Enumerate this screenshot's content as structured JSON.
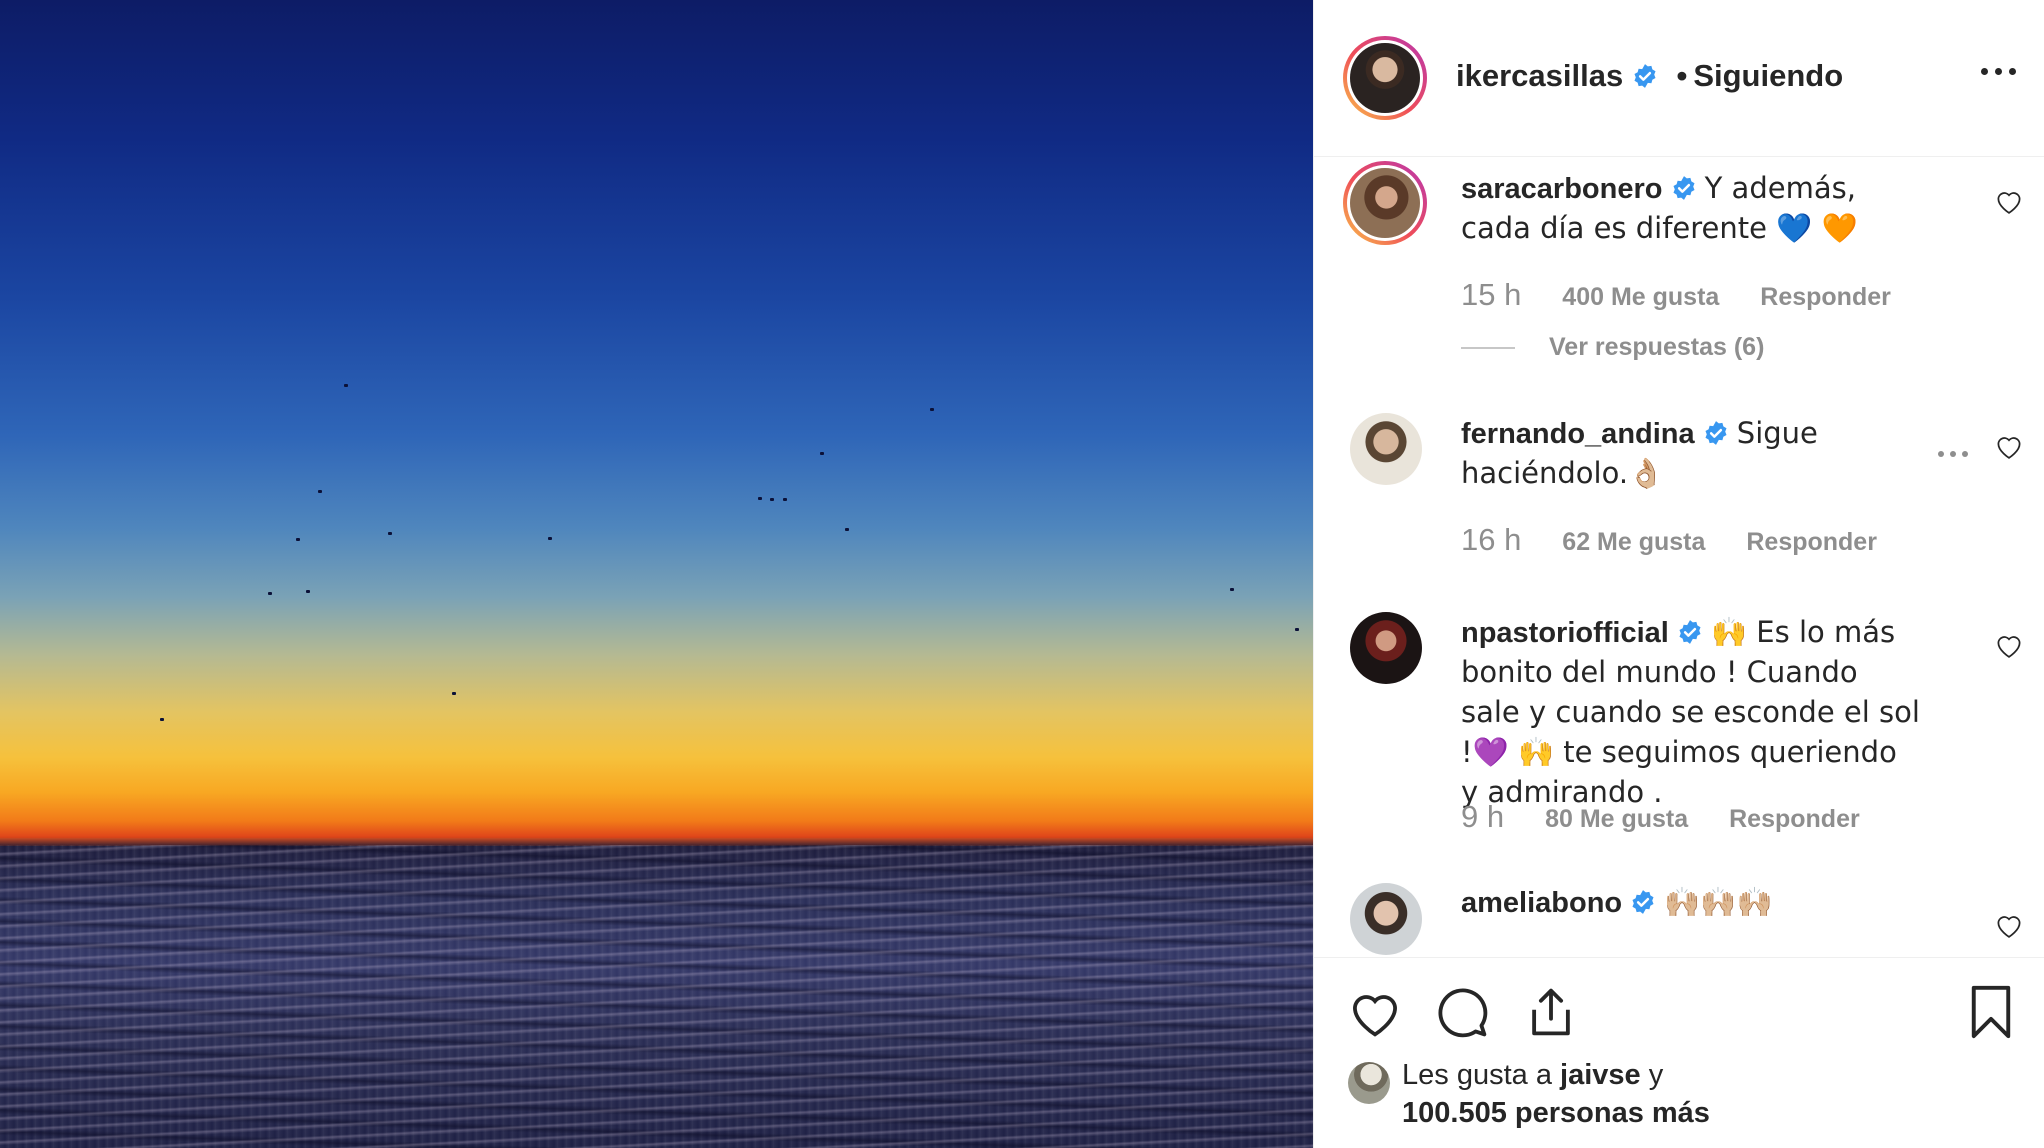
{
  "post": {
    "image_icon": "sunset-over-sea-photo"
  },
  "header": {
    "username": "ikercasillas",
    "separator": "•",
    "follow_state": "Siguiendo"
  },
  "comments": [
    {
      "username": "saracarbonero",
      "text": "Y además, cada día es diferente 💙 🧡",
      "time": "15 h",
      "likes": "400 Me gusta",
      "reply_label": "Responder",
      "view_replies": "Ver respuestas (6)"
    },
    {
      "username": "fernando_andina",
      "text": "Sigue haciéndolo.👌🏼",
      "time": "16 h",
      "likes": "62 Me gusta",
      "reply_label": "Responder"
    },
    {
      "username": "npastoriofficial",
      "text": "🙌  Es lo más bonito del mundo ! Cuando sale y cuando se esconde el sol !💜 🙌  te seguimos queriendo y admirando .",
      "time": "9 h",
      "likes": "80 Me gusta",
      "reply_label": "Responder"
    },
    {
      "username": "ameliabono",
      "text": "🙌🏼🙌🏼🙌🏼"
    }
  ],
  "footer": {
    "likes_prefix": "Les gusta a",
    "liker": "jaivse",
    "likes_connector": "y",
    "likes_count": "100.505 personas más"
  },
  "colors": {
    "verified": "#3897f0",
    "text": "#262626",
    "muted": "#8e8e8e",
    "story_ring_start": "#f9c54a",
    "story_ring_end": "#c23aa0"
  }
}
